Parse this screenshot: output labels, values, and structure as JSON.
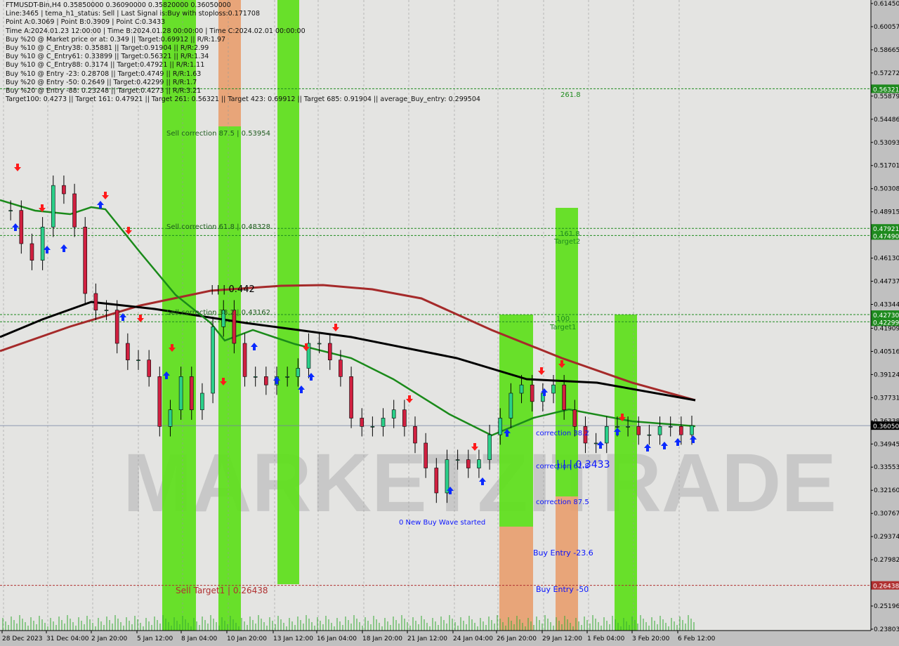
{
  "header": {
    "lines": [
      "FTMUSDT-Bin,H4  0.35850000 0.36090000 0.35820000 0.36050000",
      "Line:3465 | tema_h1_status: Sell | Last Signal is:Buy with stoploss:0.171708",
      "Point A:0.3069 | Point B:0.3909 | Point C:0.3433",
      "Time A:2024.01.23 12:00:00 | Time B:2024.01.28 00:00:00 | Time C:2024.02.01 00:00:00",
      "Buy %20 @ Market price or at: 0.349 || Target:0.69912 || R/R:1.97",
      "Buy %10 @ C_Entry38: 0.35881 || Target:0.91904 || R/R:2.99",
      "Buy %10 @ C_Entry61: 0.33899 || Target:0.56321 || R/R:1.34",
      "Buy %10 @ C_Entry88: 0.3174 || Target:0.47921 || R/R:1.11",
      "Buy %10 @ Entry -23: 0.28708 || Target:0.4749 || R/R:1.63",
      "Buy %20 @ Entry -50: 0.2649 || Target:0.42299 || R/R:1.7",
      "Buy %20 @ Entry -88: 0.23248 || Target:0.4273 || R/R:3.21",
      "Target100: 0.4273 || Target 161: 0.47921 || Target 261: 0.56321 || Target 423: 0.69912 || Target 685: 0.91904 || average_Buy_entry: 0.299504"
    ]
  },
  "watermark": "MARKETZITRADE",
  "colors": {
    "bg": "#e4e4e2",
    "axis_bg": "#c0c0c0",
    "green_zone": "#5de01a",
    "orange_zone": "#e8a070",
    "ma_red": "#a52a2a",
    "ma_black": "#000000",
    "ma_green": "#1a8a1a",
    "buy_arrow": "#0a2aff",
    "sell_arrow": "#ff1a1a"
  },
  "chart_data": {
    "type": "candlestick",
    "symbol": "FTMUSDT-Bin",
    "timeframe": "H4",
    "ylim": [
      0.23803,
      0.6145
    ],
    "y_ticks": [
      "0.61450",
      "0.60057",
      "0.58665",
      "0.57272",
      "0.55879",
      "0.54486",
      "0.53093",
      "0.51701",
      "0.50308",
      "0.48915",
      "0.46130",
      "0.44737",
      "0.43344",
      "0.41909",
      "0.40516",
      "0.39124",
      "0.37731",
      "0.36338",
      "0.34945",
      "0.33553",
      "0.32160",
      "0.30767",
      "0.29374",
      "0.27982",
      "0.25196",
      "0.23803"
    ],
    "x_ticks": [
      "28 Dec 2023",
      "31 Dec 04:00",
      "2 Jan 20:00",
      "5 Jan 12:00",
      "8 Jan 04:00",
      "10 Jan 20:00",
      "13 Jan 12:00",
      "16 Jan 04:00",
      "18 Jan 20:00",
      "21 Jan 12:00",
      "24 Jan 04:00",
      "26 Jan 20:00",
      "29 Jan 12:00",
      "1 Feb 04:00",
      "3 Feb 20:00",
      "6 Feb 12:00"
    ],
    "closes": [
      0.49,
      0.49,
      0.47,
      0.46,
      0.48,
      0.505,
      0.5,
      0.48,
      0.44,
      0.43,
      0.43,
      0.41,
      0.4,
      0.4,
      0.39,
      0.36,
      0.37,
      0.39,
      0.37,
      0.38,
      0.42,
      0.43,
      0.41,
      0.39,
      0.39,
      0.385,
      0.39,
      0.39,
      0.395,
      0.41,
      0.41,
      0.4,
      0.39,
      0.365,
      0.36,
      0.36,
      0.365,
      0.37,
      0.36,
      0.35,
      0.335,
      0.32,
      0.34,
      0.34,
      0.335,
      0.34,
      0.355,
      0.365,
      0.38,
      0.385,
      0.375,
      0.38,
      0.385,
      0.37,
      0.36,
      0.35,
      0.35,
      0.36,
      0.36,
      0.36,
      0.355,
      0.355,
      0.36,
      0.36,
      0.355,
      0.3605
    ],
    "price_levels": [
      {
        "value": "0.56321",
        "price": 0.56321,
        "color": "#1e8a1e"
      },
      {
        "value": "0.47921",
        "price": 0.47921,
        "color": "#1e8a1e"
      },
      {
        "value": "0.47490",
        "price": 0.4749,
        "color": "#1e8a1e"
      },
      {
        "value": "0.42730",
        "price": 0.4273,
        "color": "#1e8a1e"
      },
      {
        "value": "0.42299",
        "price": 0.42299,
        "color": "#1e8a1e"
      },
      {
        "value": "0.26438",
        "price": 0.26438,
        "color": "#b03030"
      }
    ],
    "current_price": {
      "value": "0.36050",
      "price": 0.3605
    },
    "annotations": [
      {
        "text": "Sell correction 87.5 | 0.53954",
        "color": "#1e5a1e"
      },
      {
        "text": "Sell correction 61.8 | 0.48328",
        "color": "#1e5a1e"
      },
      {
        "text": "Sell correction 38.2 | 0.43162",
        "color": "#1e5a1e"
      },
      {
        "text": "| | | 0.442",
        "color": "#000000"
      },
      {
        "text": "Sell Target1 | 0.26438",
        "color": "#b03030"
      },
      {
        "text": "261.8",
        "color": "#1e8a1e"
      },
      {
        "text": "161.8",
        "color": "#1e8a1e"
      },
      {
        "text": "Target2",
        "color": "#1e8a1e"
      },
      {
        "text": "100",
        "color": "#1e8a1e"
      },
      {
        "text": "Target1",
        "color": "#1e8a1e"
      },
      {
        "text": "correction 38.2",
        "color": "#0a14ff"
      },
      {
        "text": "correction 61.8",
        "color": "#0a14ff"
      },
      {
        "text": "| | | 0.3433",
        "color": "#0a14ff"
      },
      {
        "text": "correction 87.5",
        "color": "#0a14ff"
      },
      {
        "text": "0 New Buy Wave started",
        "color": "#0a14ff"
      },
      {
        "text": "Buy Entry -23.6",
        "color": "#0a14ff"
      },
      {
        "text": "Buy Entry -50",
        "color": "#0a14ff"
      }
    ]
  }
}
